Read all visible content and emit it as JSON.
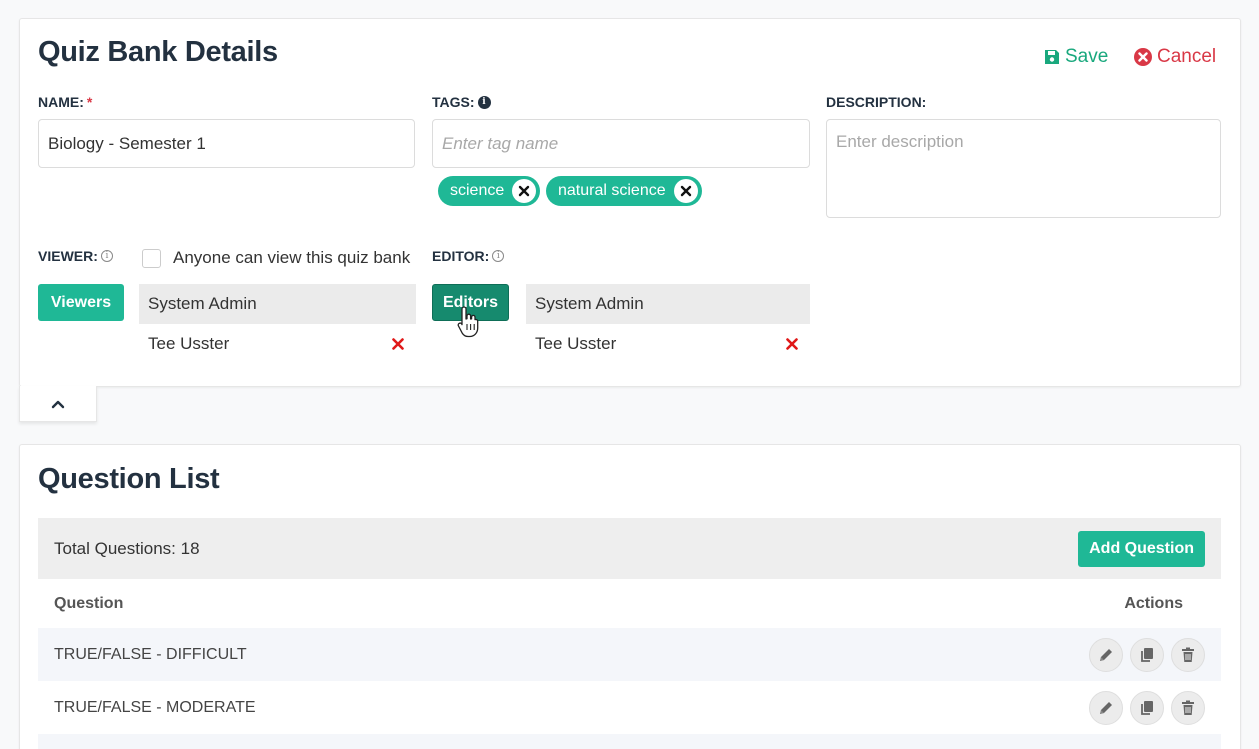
{
  "details": {
    "title": "Quiz Bank Details",
    "save_label": "Save",
    "cancel_label": "Cancel",
    "name_label": "NAME:",
    "required_mark": "*",
    "name_value": "Biology - Semester 1",
    "tags_label": "TAGS:",
    "tags_placeholder": "Enter tag name",
    "tags": [
      "science",
      "natural science"
    ],
    "description_label": "DESCRIPTION:",
    "description_placeholder": "Enter description",
    "viewer_label": "VIEWER:",
    "anyone_can_view_label": "Anyone can view this quiz bank",
    "viewers_button": "Viewers",
    "viewers": [
      "System Admin",
      "Tee Usster"
    ],
    "editor_label": "EDITOR:",
    "editors_button": "Editors",
    "editors": [
      "System Admin",
      "Tee Usster"
    ]
  },
  "question_list": {
    "title": "Question List",
    "total_label": "Total Questions: 18",
    "add_button": "Add Question",
    "columns": [
      "Question",
      "Actions"
    ],
    "rows": [
      "TRUE/FALSE - DIFFICULT",
      "TRUE/FALSE - MODERATE"
    ]
  },
  "colors": {
    "accent": "#1fb896",
    "save": "#19a87d",
    "cancel": "#d93846",
    "title": "#233140"
  },
  "icons": {
    "save": "floppy-disk-icon",
    "cancel": "times-circle-icon",
    "edit": "pencil-icon",
    "copy": "copy-icon",
    "delete": "trash-icon"
  }
}
